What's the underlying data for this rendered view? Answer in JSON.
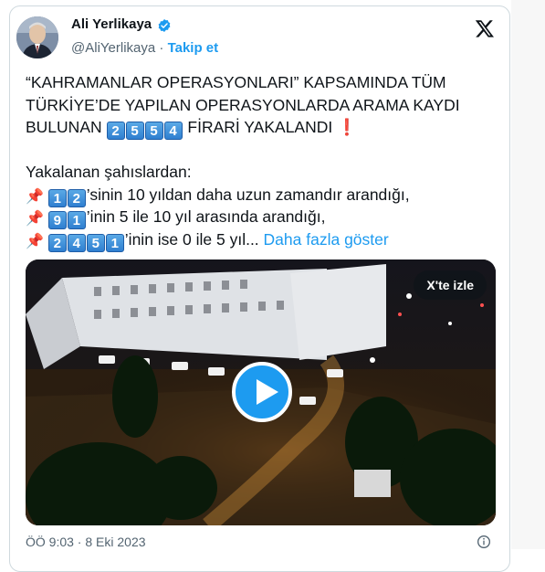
{
  "author": {
    "name": "Ali Yerlikaya",
    "handle": "@AliYerlikaya",
    "separator": "·",
    "follow_label": "Takip et",
    "verified_color": "#1d9bf0"
  },
  "icons": [
    "x-logo-icon",
    "verified-badge-icon",
    "pushpin-icon",
    "exclamation-icon",
    "play-icon",
    "info-icon"
  ],
  "tweet": {
    "line1": "“KAHRAMANLAR OPERASYONLARI” KAPSAMINDA TÜM",
    "line2": "TÜRKİYE’DE YAPILAN OPERASYONLARDA ARAMA KAYDI",
    "line3_prefix": "BULUNAN",
    "line3_digits": [
      "2",
      "5",
      "5",
      "4"
    ],
    "line3_suffix": "FİRARİ YAKALANDI",
    "line3_exclaim": "❗",
    "intro": "Yakalanan şahıslardan:",
    "pin": "📌",
    "item1_digits": [
      "1",
      "2"
    ],
    "item1_text": "’sinin 10 yıldan daha uzun zamandır arandığı,",
    "item2_digits": [
      "9",
      "1"
    ],
    "item2_text": "’inin 5 ile 10 yıl arasında arandığı,",
    "item3_digits": [
      "2",
      "4",
      "5",
      "1"
    ],
    "item3_text": "’inin ise 0 ile 5 yıl...",
    "show_more": "Daha fazla göster"
  },
  "media": {
    "watch_on_x": "X'te izle"
  },
  "footer": {
    "timestamp": "ÖÖ 9:03 · 8 Eki 2023"
  },
  "colors": {
    "accent": "#1d9bf0",
    "text": "#0f1419",
    "secondary": "#536471",
    "keycap": "#2f7fd0"
  }
}
